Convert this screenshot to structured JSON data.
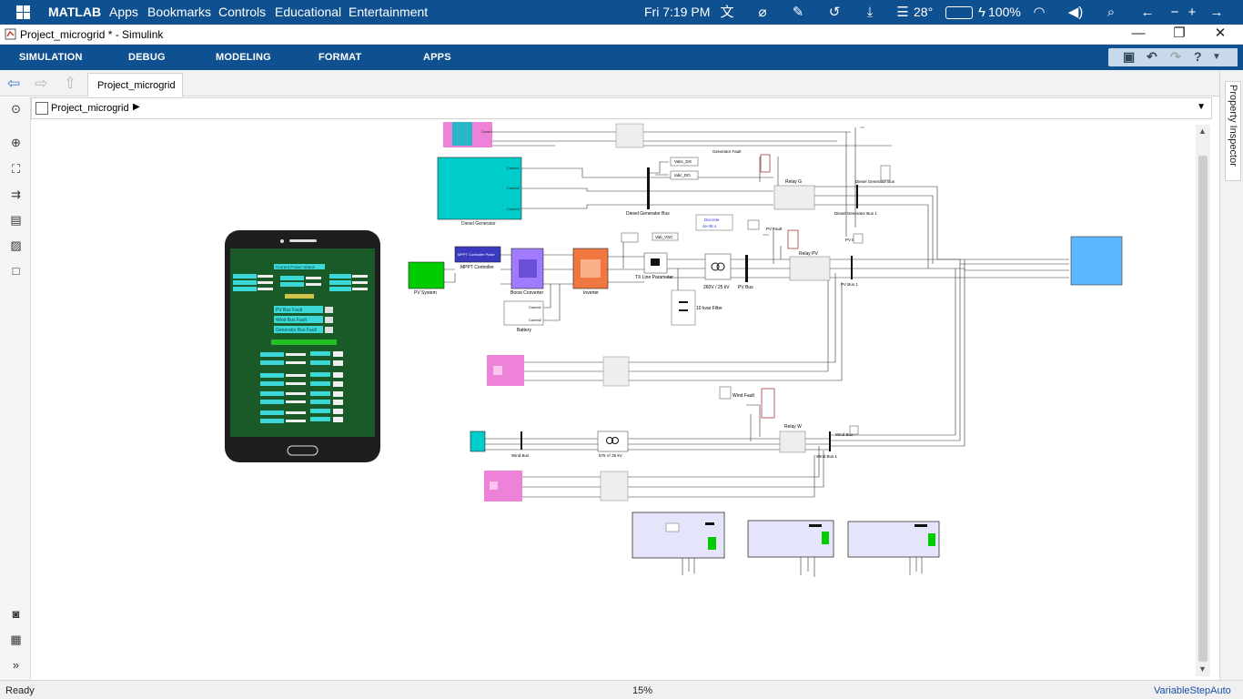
{
  "os": {
    "app_name": "MATLAB",
    "menu": [
      "Apps",
      "Bookmarks",
      "Controls",
      "Educational",
      "Entertainment"
    ],
    "datetime": "Fri 7:19 PM",
    "temperature": "28°",
    "battery": "100%"
  },
  "window": {
    "title": "Project_microgrid * - Simulink",
    "minimize": "—",
    "maximize": "❐",
    "close": "✕"
  },
  "ribbon": {
    "tabs": [
      "SIMULATION",
      "DEBUG",
      "MODELING",
      "FORMAT",
      "APPS"
    ]
  },
  "nav": {
    "doc_tab": "Project_microgrid",
    "address": "Project_microgrid"
  },
  "inspector": {
    "label": "Property Inspector"
  },
  "status": {
    "left": "Ready",
    "zoom": "15%",
    "solver": "VariableStepAuto"
  },
  "diagram": {
    "labels": {
      "diesel_gen": "Diesel Generator",
      "diesel_bus": "Diesel Generator Bus",
      "diesel_bus1": "Diesel Generator Bus 1",
      "diesel_bus_small": "Diesel Generator Bus",
      "gen_fault": "Generator Fault",
      "relay_g": "Relay G",
      "vabc_dg": "Vabc_DG",
      "iabc_dg": "Iabc_DG",
      "discrete_line1": "Discrete",
      "discrete_line2": "4e-06 s.",
      "pv_system": "PV System",
      "mppt": "MPPT Controller",
      "mppt_inner": "MPPT Controller Pulse",
      "boost": "Boost Converter",
      "battery": "Battery",
      "inverter": "Inverter",
      "tx_line": "TX Line Parameter",
      "xfmr_pv": "260V / 25 kV",
      "pv_bus": "PV Bus",
      "relay_pv": "Relay PV",
      "pv_bus1": "PV Bus 1",
      "pv_bus_small": "PV Bus",
      "pv_fault": "PV Fault",
      "filter": "10 kvar Filter",
      "vab_vsc": "Vab_VSC",
      "wind_bus": "Wind Bus",
      "xfmr_wind": "575 V/ 25 kV",
      "relay_w": "Relay W",
      "wind_bus1": "Wind Bus 1",
      "wind_bus_small": "Wind Bus",
      "wind_fault": "Wind Fault",
      "comm1": "Comm1",
      "comm2": "Comm2",
      "comm3": "Comm3"
    }
  },
  "phone": {
    "title": "Current Power Status",
    "faults": [
      "PV Bus Fault",
      "Wind Bus Fault",
      "Generator Bus Fault"
    ]
  },
  "colors": {
    "os_blue": "#0f5190",
    "cyan": "#00cccc",
    "green": "#00cc00",
    "pink": "#ee82d8",
    "orange": "#f07840",
    "purple": "#9966ff",
    "sky": "#5cb8ff"
  },
  "icons": {
    "windows": "windows-logo-icon",
    "translate": "translate-icon",
    "pen": "pen-icon",
    "history": "history-icon",
    "download": "download-icon",
    "weather": "weather-icon",
    "wifi": "wifi-icon",
    "volume": "volume-icon",
    "search": "search-icon"
  }
}
